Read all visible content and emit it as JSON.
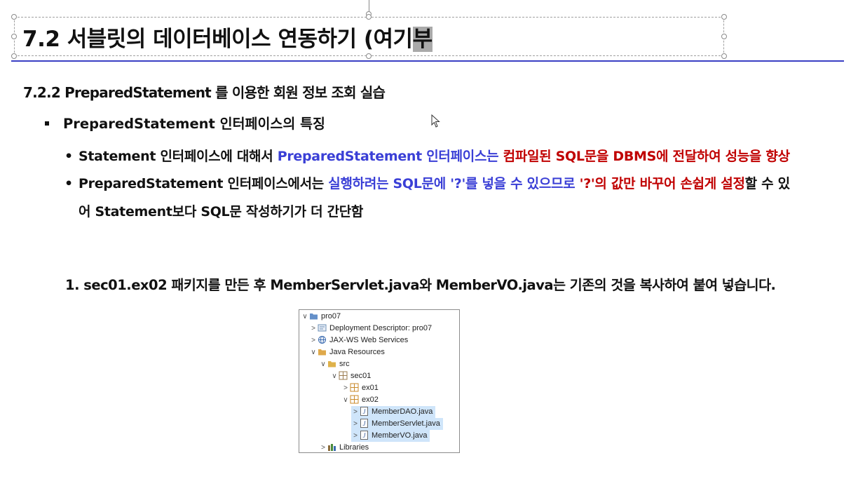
{
  "title": {
    "main": "7.2 서블릿의 데이터베이스 연동하기 (여기",
    "highlight": "부"
  },
  "section_heading": "7.2.2 PreparedStatement 를 이용한 회원 정보 조회 실습",
  "bullet_main": "PreparedStatement 인터페이스의 특징",
  "point1": {
    "a": "Statement 인터페이스에 대해서 ",
    "b": "PreparedStatement 인터페이스는 ",
    "c": "컴파일된 SQL문을 DBMS에 전달하여 성능을 향상"
  },
  "point2": {
    "a": "PreparedStatement 인터페이스에서는 ",
    "b": "실행하려는 SQL문에 '?'를 넣을 수 있으므로 ",
    "c": "'?'의 값만 바꾸어 손쉽게 설정",
    "d": "할 수 있",
    "e": "어 Statement보다 SQL문 작성하기가 더 간단함"
  },
  "step1": "1. sec01.ex02 패키지를 만든 후 MemberServlet.java와 MemberVO.java는 기존의 것을 복사하여 붙여 넣습니다.",
  "explorer": {
    "items": [
      {
        "label": "pro07",
        "arrow": "∨",
        "icon": "project-icon",
        "color": "#4a7cc0"
      },
      {
        "label": "Deployment Descriptor: pro07",
        "arrow": ">",
        "icon": "descriptor-icon",
        "color": "#6b8fb5"
      },
      {
        "label": "JAX-WS Web Services",
        "arrow": ">",
        "icon": "webservice-icon",
        "color": "#3a6bb0"
      },
      {
        "label": "Java Resources",
        "arrow": "∨",
        "icon": "java-resources-icon",
        "color": "#d99a2b"
      },
      {
        "label": "src",
        "arrow": "∨",
        "icon": "source-folder-icon",
        "color": "#d9a42b"
      },
      {
        "label": "sec01",
        "arrow": "∨",
        "icon": "package-icon",
        "color": "#9a7b4f"
      },
      {
        "label": "ex01",
        "arrow": ">",
        "icon": "package-icon",
        "color": "#c98a2a"
      },
      {
        "label": "ex02",
        "arrow": "∨",
        "icon": "package-icon",
        "color": "#c98a2a"
      },
      {
        "label": "MemberDAO.java",
        "arrow": ">",
        "icon": "java-file-icon",
        "color": "#6b6b6b"
      },
      {
        "label": "MemberServlet.java",
        "arrow": ">",
        "icon": "java-file-icon",
        "color": "#6b6b6b"
      },
      {
        "label": "MemberVO.java",
        "arrow": ">",
        "icon": "java-file-icon",
        "color": "#6b6b6b"
      },
      {
        "label": "Libraries",
        "arrow": ">",
        "icon": "libraries-icon",
        "color": "#8a6b3a"
      }
    ]
  },
  "colors": {
    "accent_blue": "#3a3fd6",
    "accent_red": "#c00000",
    "rule": "#3a3fc4"
  }
}
